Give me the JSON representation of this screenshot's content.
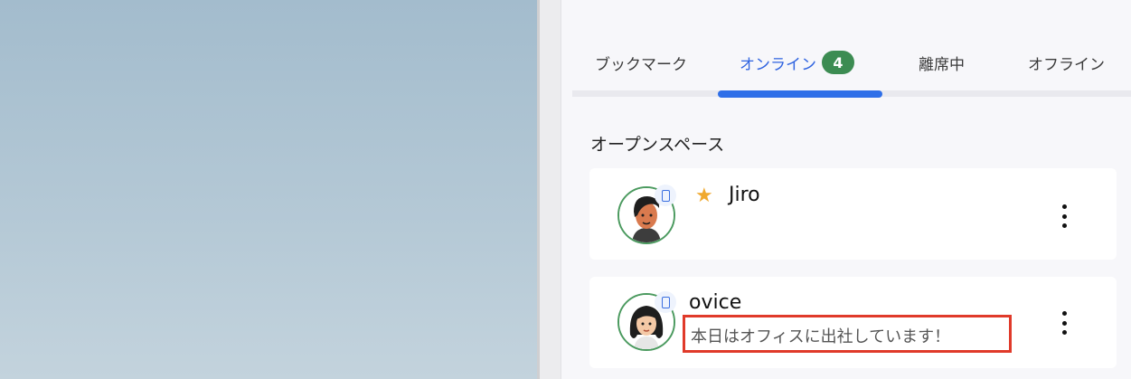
{
  "tabs": [
    {
      "label": "ブックマーク"
    },
    {
      "label": "オンライン",
      "count": "4"
    },
    {
      "label": "離席中"
    },
    {
      "label": "オフライン"
    }
  ],
  "section": {
    "title": "オープンスペース"
  },
  "users": [
    {
      "name": "Jiro",
      "bookmarked": true,
      "status": ""
    },
    {
      "name": "ovice",
      "bookmarked": false,
      "status": "本日はオフィスに出社しています！"
    }
  ],
  "colors": {
    "accent": "#2f6fe8",
    "badge": "#3c8c52",
    "highlight": "#e03a2a",
    "star": "#f0a92e"
  }
}
